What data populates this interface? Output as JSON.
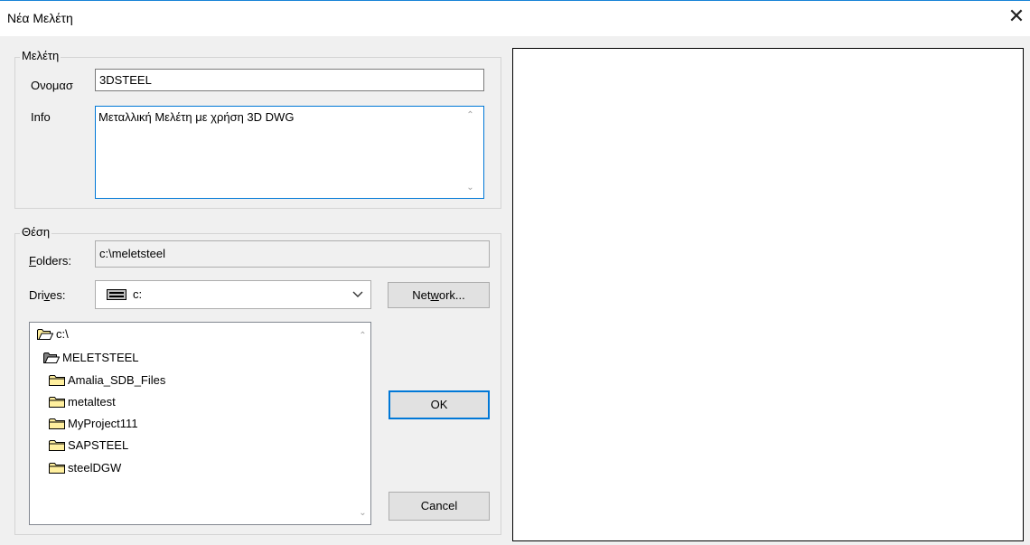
{
  "window": {
    "title": "Νέα Μελέτη",
    "close_glyph": "✕"
  },
  "study_group": {
    "legend": "Μελέτη",
    "name_label": "Ονομασ",
    "name_value": "3DSTEEL",
    "info_label": "Info",
    "info_value": "Μεταλλική Μελέτη με χρήση 3D DWG"
  },
  "location_group": {
    "legend": "Θέση",
    "folders_label_pre": "",
    "folders_label_u": "F",
    "folders_label_post": "olders:",
    "folders_value": "c:\\meletsteel",
    "drives_label_pre": "Dri",
    "drives_label_u": "v",
    "drives_label_post": "es:",
    "drives_value": "c:",
    "network_pre": "Net",
    "network_u": "w",
    "network_post": "ork..."
  },
  "tree": {
    "items": [
      "c:\\",
      "MELETSTEEL",
      "Amalia_SDB_Files",
      "metaltest",
      "MyProject111",
      "SAPSTEEL",
      "steelDGW"
    ]
  },
  "buttons": {
    "ok": "OK",
    "cancel": "Cancel"
  },
  "icons": {
    "close": "close-icon",
    "drive": "drive-icon",
    "folder_open": "folder-open-icon",
    "folder": "folder-icon",
    "chevron": "chevron-down-icon"
  }
}
